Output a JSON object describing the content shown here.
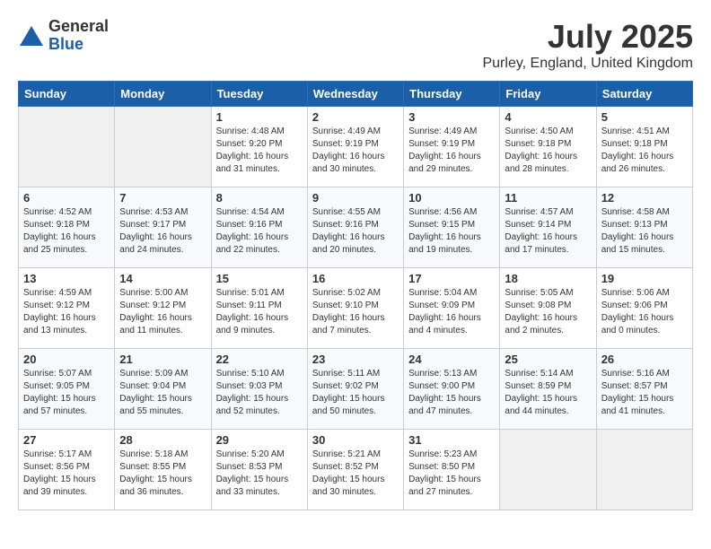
{
  "logo": {
    "general": "General",
    "blue": "Blue"
  },
  "title": "July 2025",
  "location": "Purley, England, United Kingdom",
  "weekdays": [
    "Sunday",
    "Monday",
    "Tuesday",
    "Wednesday",
    "Thursday",
    "Friday",
    "Saturday"
  ],
  "weeks": [
    [
      {
        "day": null
      },
      {
        "day": null
      },
      {
        "day": "1",
        "sunrise": "Sunrise: 4:48 AM",
        "sunset": "Sunset: 9:20 PM",
        "daylight": "Daylight: 16 hours and 31 minutes."
      },
      {
        "day": "2",
        "sunrise": "Sunrise: 4:49 AM",
        "sunset": "Sunset: 9:19 PM",
        "daylight": "Daylight: 16 hours and 30 minutes."
      },
      {
        "day": "3",
        "sunrise": "Sunrise: 4:49 AM",
        "sunset": "Sunset: 9:19 PM",
        "daylight": "Daylight: 16 hours and 29 minutes."
      },
      {
        "day": "4",
        "sunrise": "Sunrise: 4:50 AM",
        "sunset": "Sunset: 9:18 PM",
        "daylight": "Daylight: 16 hours and 28 minutes."
      },
      {
        "day": "5",
        "sunrise": "Sunrise: 4:51 AM",
        "sunset": "Sunset: 9:18 PM",
        "daylight": "Daylight: 16 hours and 26 minutes."
      }
    ],
    [
      {
        "day": "6",
        "sunrise": "Sunrise: 4:52 AM",
        "sunset": "Sunset: 9:18 PM",
        "daylight": "Daylight: 16 hours and 25 minutes."
      },
      {
        "day": "7",
        "sunrise": "Sunrise: 4:53 AM",
        "sunset": "Sunset: 9:17 PM",
        "daylight": "Daylight: 16 hours and 24 minutes."
      },
      {
        "day": "8",
        "sunrise": "Sunrise: 4:54 AM",
        "sunset": "Sunset: 9:16 PM",
        "daylight": "Daylight: 16 hours and 22 minutes."
      },
      {
        "day": "9",
        "sunrise": "Sunrise: 4:55 AM",
        "sunset": "Sunset: 9:16 PM",
        "daylight": "Daylight: 16 hours and 20 minutes."
      },
      {
        "day": "10",
        "sunrise": "Sunrise: 4:56 AM",
        "sunset": "Sunset: 9:15 PM",
        "daylight": "Daylight: 16 hours and 19 minutes."
      },
      {
        "day": "11",
        "sunrise": "Sunrise: 4:57 AM",
        "sunset": "Sunset: 9:14 PM",
        "daylight": "Daylight: 16 hours and 17 minutes."
      },
      {
        "day": "12",
        "sunrise": "Sunrise: 4:58 AM",
        "sunset": "Sunset: 9:13 PM",
        "daylight": "Daylight: 16 hours and 15 minutes."
      }
    ],
    [
      {
        "day": "13",
        "sunrise": "Sunrise: 4:59 AM",
        "sunset": "Sunset: 9:12 PM",
        "daylight": "Daylight: 16 hours and 13 minutes."
      },
      {
        "day": "14",
        "sunrise": "Sunrise: 5:00 AM",
        "sunset": "Sunset: 9:12 PM",
        "daylight": "Daylight: 16 hours and 11 minutes."
      },
      {
        "day": "15",
        "sunrise": "Sunrise: 5:01 AM",
        "sunset": "Sunset: 9:11 PM",
        "daylight": "Daylight: 16 hours and 9 minutes."
      },
      {
        "day": "16",
        "sunrise": "Sunrise: 5:02 AM",
        "sunset": "Sunset: 9:10 PM",
        "daylight": "Daylight: 16 hours and 7 minutes."
      },
      {
        "day": "17",
        "sunrise": "Sunrise: 5:04 AM",
        "sunset": "Sunset: 9:09 PM",
        "daylight": "Daylight: 16 hours and 4 minutes."
      },
      {
        "day": "18",
        "sunrise": "Sunrise: 5:05 AM",
        "sunset": "Sunset: 9:08 PM",
        "daylight": "Daylight: 16 hours and 2 minutes."
      },
      {
        "day": "19",
        "sunrise": "Sunrise: 5:06 AM",
        "sunset": "Sunset: 9:06 PM",
        "daylight": "Daylight: 16 hours and 0 minutes."
      }
    ],
    [
      {
        "day": "20",
        "sunrise": "Sunrise: 5:07 AM",
        "sunset": "Sunset: 9:05 PM",
        "daylight": "Daylight: 15 hours and 57 minutes."
      },
      {
        "day": "21",
        "sunrise": "Sunrise: 5:09 AM",
        "sunset": "Sunset: 9:04 PM",
        "daylight": "Daylight: 15 hours and 55 minutes."
      },
      {
        "day": "22",
        "sunrise": "Sunrise: 5:10 AM",
        "sunset": "Sunset: 9:03 PM",
        "daylight": "Daylight: 15 hours and 52 minutes."
      },
      {
        "day": "23",
        "sunrise": "Sunrise: 5:11 AM",
        "sunset": "Sunset: 9:02 PM",
        "daylight": "Daylight: 15 hours and 50 minutes."
      },
      {
        "day": "24",
        "sunrise": "Sunrise: 5:13 AM",
        "sunset": "Sunset: 9:00 PM",
        "daylight": "Daylight: 15 hours and 47 minutes."
      },
      {
        "day": "25",
        "sunrise": "Sunrise: 5:14 AM",
        "sunset": "Sunset: 8:59 PM",
        "daylight": "Daylight: 15 hours and 44 minutes."
      },
      {
        "day": "26",
        "sunrise": "Sunrise: 5:16 AM",
        "sunset": "Sunset: 8:57 PM",
        "daylight": "Daylight: 15 hours and 41 minutes."
      }
    ],
    [
      {
        "day": "27",
        "sunrise": "Sunrise: 5:17 AM",
        "sunset": "Sunset: 8:56 PM",
        "daylight": "Daylight: 15 hours and 39 minutes."
      },
      {
        "day": "28",
        "sunrise": "Sunrise: 5:18 AM",
        "sunset": "Sunset: 8:55 PM",
        "daylight": "Daylight: 15 hours and 36 minutes."
      },
      {
        "day": "29",
        "sunrise": "Sunrise: 5:20 AM",
        "sunset": "Sunset: 8:53 PM",
        "daylight": "Daylight: 15 hours and 33 minutes."
      },
      {
        "day": "30",
        "sunrise": "Sunrise: 5:21 AM",
        "sunset": "Sunset: 8:52 PM",
        "daylight": "Daylight: 15 hours and 30 minutes."
      },
      {
        "day": "31",
        "sunrise": "Sunrise: 5:23 AM",
        "sunset": "Sunset: 8:50 PM",
        "daylight": "Daylight: 15 hours and 27 minutes."
      },
      {
        "day": null
      },
      {
        "day": null
      }
    ]
  ]
}
